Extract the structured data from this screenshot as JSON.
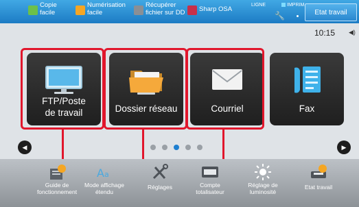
{
  "topbar": {
    "quick_actions": [
      {
        "label": "Copie\nfacile",
        "icon": "copy-icon",
        "color": "#6cc04a"
      },
      {
        "label": "Numérisation\nfacile",
        "icon": "scan-icon",
        "color": "#f5a623"
      },
      {
        "label": "Récupérer\nfichier sur DD",
        "icon": "retrieve-file-icon",
        "color": "#8a8f95"
      },
      {
        "label": "Sharp OSA",
        "icon": "sharp-osa-icon",
        "color": "#c7304a"
      }
    ],
    "line_indicator": "LIGNE",
    "print_indicator": "IMPRIM.",
    "job_status_button": "Etat travail"
  },
  "clock": "10:15",
  "tiles": [
    {
      "label": "FTP/Poste\nde travail",
      "icon": "monitor-icon"
    },
    {
      "label": "Dossier réseau",
      "icon": "folder-icon"
    },
    {
      "label": "Courriel",
      "icon": "envelope-icon"
    },
    {
      "label": "Fax",
      "icon": "fax-icon"
    }
  ],
  "carousel": {
    "pages": 5,
    "active_page": 2
  },
  "bottombar": {
    "items": [
      {
        "label": "Guide de\nfonctionnement",
        "icon": "guide-icon"
      },
      {
        "label": "Mode affichage\nétendu",
        "icon": "zoom-text-icon"
      },
      {
        "label": "Réglages",
        "icon": "settings-icon"
      },
      {
        "label": "Compte\ntotalisateur",
        "icon": "counter-icon"
      },
      {
        "label": "Réglage de\nluminosité",
        "icon": "brightness-icon"
      },
      {
        "label": "Etat travail",
        "icon": "job-status-icon"
      }
    ]
  },
  "colors": {
    "topbar": "#2a8fd6",
    "highlight": "#e1162c",
    "tile": "#2b2b2b",
    "active_dot": "#1e7fd0"
  }
}
